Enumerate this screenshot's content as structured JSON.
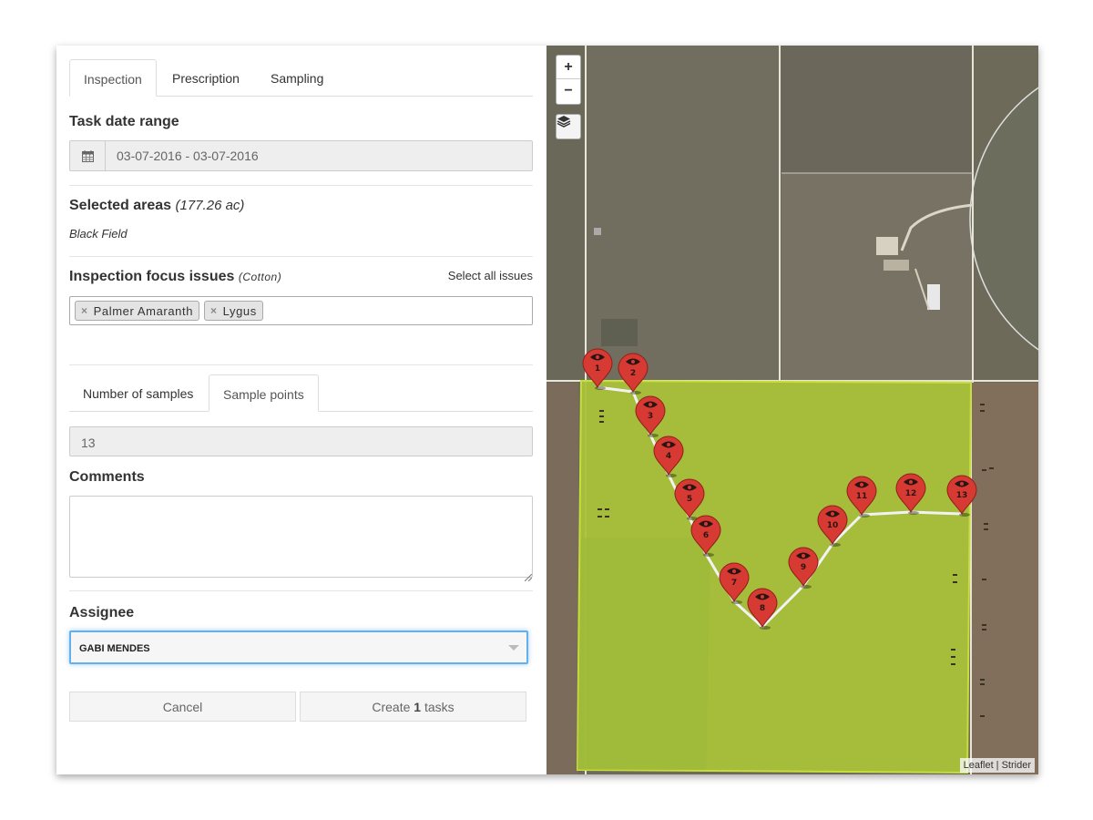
{
  "tabs": [
    {
      "label": "Inspection",
      "active": true
    },
    {
      "label": "Prescription",
      "active": false
    },
    {
      "label": "Sampling",
      "active": false
    }
  ],
  "task_date": {
    "title": "Task date range",
    "icon": "calendar-icon",
    "value": "03-07-2016 - 03-07-2016"
  },
  "areas": {
    "title": "Selected areas",
    "acres": "(177.26 ac)",
    "name": "Black Field"
  },
  "focus": {
    "title": "Inspection focus issues",
    "crop": "(Cotton)",
    "select_all": "Select all issues",
    "tags": [
      "Palmer Amaranth",
      "Lygus"
    ],
    "remove_glyph": "×"
  },
  "sample_tabs": [
    {
      "label": "Number of samples",
      "active": false
    },
    {
      "label": "Sample points",
      "active": true
    }
  ],
  "samples_value": "13",
  "comments": {
    "title": "Comments",
    "value": ""
  },
  "assignee": {
    "title": "Assignee",
    "value": "GABI MENDES"
  },
  "buttons": {
    "cancel": "Cancel",
    "create_prefix": "Create",
    "create_count": "1",
    "create_suffix": "tasks"
  },
  "map": {
    "zoom_in": "+",
    "zoom_out": "−",
    "layers_icon": "layers-icon",
    "attribution": "Leaflet | Strider",
    "field_color": "#a8c23a",
    "marker_color": "#d63a33",
    "marker_labels": [
      "1",
      "2",
      "3",
      "4",
      "5",
      "6",
      "7",
      "8",
      "9",
      "10",
      "11",
      "12",
      "13"
    ]
  }
}
